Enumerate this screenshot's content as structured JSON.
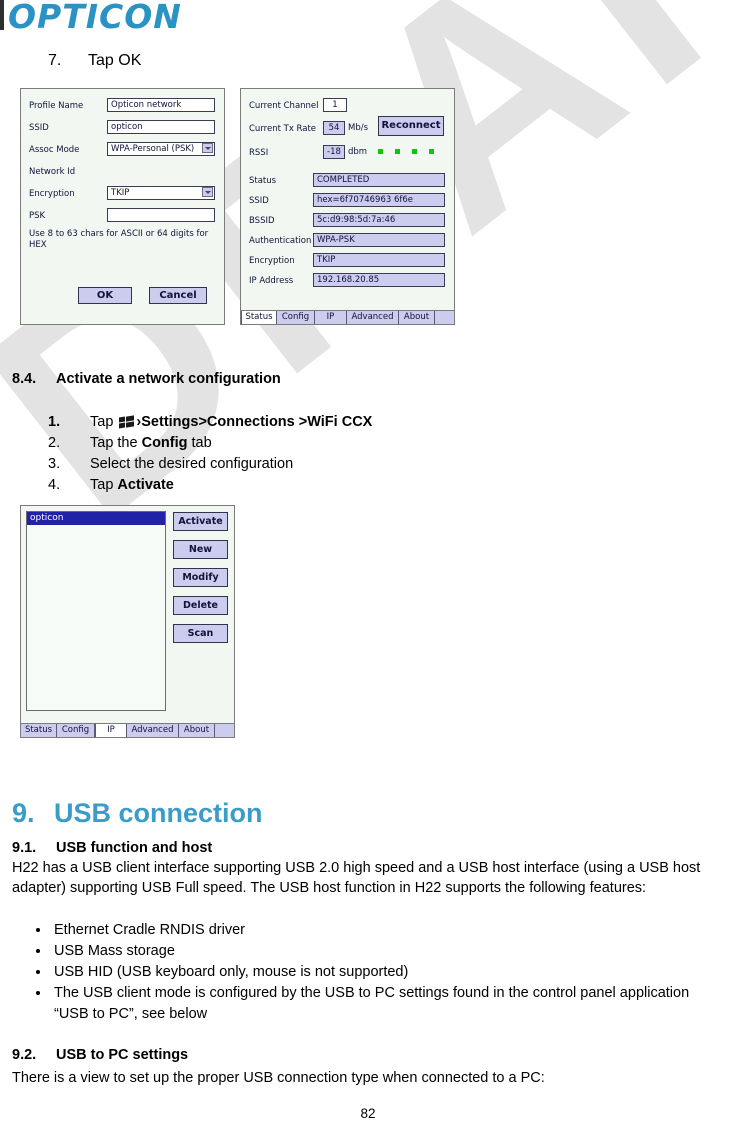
{
  "document": {
    "brand": "OPTICON",
    "watermark": "DRAFT",
    "page_number": "82"
  },
  "step7": {
    "number": "7.",
    "text": "Tap OK"
  },
  "screenshot_profile": {
    "left_panel": {
      "fields": [
        {
          "label": "Profile Name",
          "value": "Opticon network",
          "type": "text"
        },
        {
          "label": "SSID",
          "value": "opticon",
          "type": "text"
        },
        {
          "label": "Assoc Mode",
          "value": "WPA-Personal (PSK)",
          "type": "combo"
        },
        {
          "label": "Network Id",
          "value": "",
          "type": "none"
        },
        {
          "label": "Encryption",
          "value": "TKIP",
          "type": "combo"
        },
        {
          "label": "PSK",
          "value": "",
          "type": "text"
        }
      ],
      "hint": "Use 8 to 63 chars for ASCII or 64 digits for HEX",
      "ok_button": "OK",
      "cancel_button": "Cancel"
    },
    "right_panel": {
      "current_channel_label": "Current Channel",
      "current_channel_value": "1",
      "tx_rate_label": "Current Tx Rate",
      "tx_rate_value": "54",
      "tx_rate_unit": "Mb/s",
      "reconnect_button": "Reconnect",
      "rssi_label": "RSSI",
      "rssi_value": "-18",
      "rssi_unit": "dbm",
      "signal_bars": 4,
      "signal_color": "#12c312",
      "rows": [
        {
          "label": "Status",
          "value": "COMPLETED"
        },
        {
          "label": "SSID",
          "value": "hex=6f70746963 6f6e"
        },
        {
          "label": "BSSID",
          "value": "5c:d9:98:5d:7a:46"
        },
        {
          "label": "Authentication",
          "value": "WPA-PSK"
        },
        {
          "label": "Encryption",
          "value": "TKIP"
        },
        {
          "label": "IP Address",
          "value": "192.168.20.85"
        }
      ],
      "tabs": [
        {
          "label": "Status",
          "active": true
        },
        {
          "label": "Config",
          "active": false
        },
        {
          "label": "IP",
          "active": false
        },
        {
          "label": "Advanced",
          "active": false
        },
        {
          "label": "About",
          "active": false
        }
      ]
    }
  },
  "section_8_4": {
    "number": "8.4.",
    "title": "Activate a network configuration",
    "steps": [
      {
        "number": "1.",
        "bold_number": true,
        "pre": "Tap ",
        "has_flag": true,
        "bold_text": "›Settings>Connections >WiFi CCX",
        "post": ""
      },
      {
        "number": "2.",
        "bold_number": false,
        "pre": "Tap the ",
        "has_flag": false,
        "bold_text": "Config",
        "post": " tab"
      },
      {
        "number": "3.",
        "bold_number": false,
        "pre": "Select the desired configuration",
        "has_flag": false,
        "bold_text": "",
        "post": ""
      },
      {
        "number": "4.",
        "bold_number": false,
        "pre": "Tap ",
        "has_flag": false,
        "bold_text": "Activate",
        "post": ""
      }
    ]
  },
  "screenshot_config": {
    "selected_item": "opticon",
    "buttons": [
      "Activate",
      "New",
      "Modify",
      "Delete",
      "Scan"
    ],
    "tabs": [
      {
        "label": "Status",
        "active": false
      },
      {
        "label": "Config",
        "active": false
      },
      {
        "label": "IP",
        "active": true
      },
      {
        "label": "Advanced",
        "active": false
      },
      {
        "label": "About",
        "active": false
      }
    ]
  },
  "section_9": {
    "number": "9.",
    "title": "USB connection",
    "accent_color": "#3a9cc9"
  },
  "section_9_1": {
    "number": "9.1.",
    "title": "USB function and host",
    "paragraph": "H22 has a USB client interface supporting USB 2.0 high speed and a USB host interface (using a USB host adapter) supporting USB Full speed. The USB host function in H22 supports the following features:",
    "bullets": [
      "Ethernet Cradle RNDIS driver",
      "USB Mass storage",
      "USB HID (USB keyboard only, mouse is not supported)",
      "The USB client mode is configured by the USB to PC settings found in the control panel application “USB to PC”, see below"
    ]
  },
  "section_9_2": {
    "number": "9.2.",
    "title": "USB to PC settings",
    "paragraph": "There is a view to set up the proper USB connection type when connected to a PC:"
  }
}
